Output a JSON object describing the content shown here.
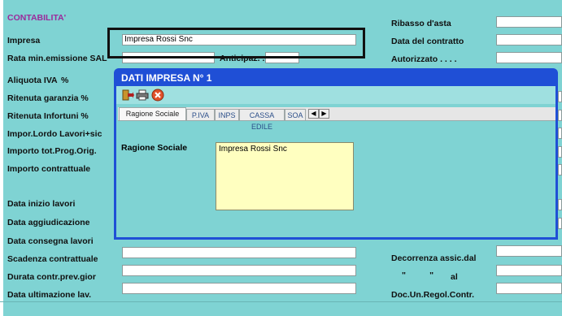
{
  "form": {
    "section_title": "CONTABILITA'",
    "labels": {
      "impresa": "Impresa",
      "rata": "Rata min.emissione SAL",
      "anticipaz": "Anticipaz. .",
      "aliquota": "Aliquota IVA",
      "aliquota_pct": "%",
      "rit_gar": "Ritenuta garanzia  %",
      "rit_inf": "Ritenuta Infortuni  %",
      "impor_lordo": "Impor.Lordo Lavori+sic",
      "importo_tot": "Importo tot.Prog.Orig.",
      "importo_contr": "Importo contrattuale",
      "data_inizio": "Data inizio lavori",
      "data_aggiud": "Data aggiudicazione",
      "data_consegna": "Data consegna lavori",
      "scadenza": "Scadenza contrattuale",
      "durata": "Durata contr.prev.gior",
      "data_ultim": "Data ultimazione lav.",
      "ribasso": "Ribasso d'asta",
      "data_contratto": "Data del contratto",
      "autorizzato": "Autorizzato . . . .",
      "decorrenza": "Decorrenza assic.dal",
      "quote_marks": "\"          \"",
      "al": "al",
      "doc_un": "Doc.Un.Regol.Contr."
    },
    "values": {
      "impresa": "Impresa Rossi Snc"
    }
  },
  "dialog": {
    "title": "DATI IMPRESA  N° 1",
    "toolbar": [
      "exit-icon",
      "print-icon",
      "close-icon"
    ],
    "tabs": [
      "Ragione Sociale",
      "P.IVA",
      "INPS",
      "CASSA EDILE",
      "SOA"
    ],
    "scroll_left": "◀",
    "scroll_right": "▶",
    "ragione_label": "Ragione Sociale",
    "ragione_value": "Impresa Rossi Snc"
  },
  "colors": {
    "form_bg": "#7fd3d3",
    "dialog_title_bg": "#1f4fd6",
    "section_title": "#9b2a9b",
    "memo_bg": "#ffffc0"
  }
}
